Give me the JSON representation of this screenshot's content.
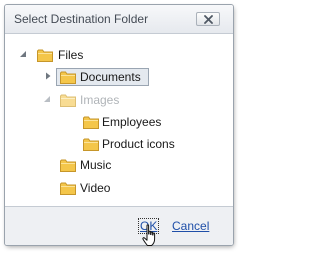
{
  "dialog": {
    "title": "Select Destination Folder",
    "close_icon": "close-x-icon"
  },
  "tree": {
    "nodes": [
      {
        "label": "Files",
        "expander": "expanded",
        "state": "normal"
      },
      {
        "label": "Documents",
        "expander": "collapsed",
        "state": "selected"
      },
      {
        "label": "Images",
        "expander": "expanded",
        "state": "disabled"
      },
      {
        "label": "Employees",
        "expander": "none",
        "state": "normal"
      },
      {
        "label": "Product icons",
        "expander": "none",
        "state": "normal"
      },
      {
        "label": "Music",
        "expander": "none",
        "state": "normal"
      },
      {
        "label": "Video",
        "expander": "none",
        "state": "normal"
      }
    ]
  },
  "footer": {
    "ok_label": "OK",
    "cancel_label": "Cancel"
  },
  "colors": {
    "folder_fill": "#f4c64a",
    "folder_stroke": "#c6962a",
    "link": "#1f4fa8",
    "selection_bg": "#e4e9ef",
    "disabled_text": "#b0b4b8"
  }
}
